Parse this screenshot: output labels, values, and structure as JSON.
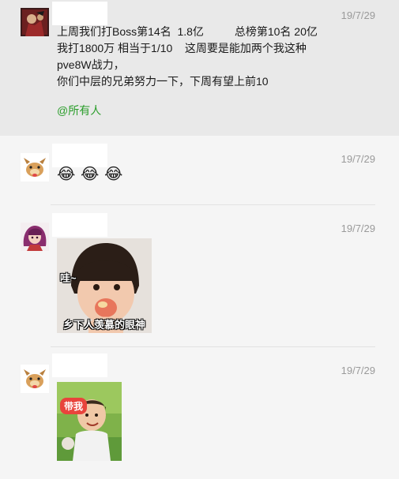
{
  "messages": [
    {
      "avatar_icon": "game-character-avatar-icon",
      "time": "19/7/29",
      "text_lines": [
        "上周我们打Boss第14名  1.8亿          总榜第10名 20亿",
        "我打1800万 相当于1/10    这周要是能加两个我这种pve8W战力，",
        "你们中层的兄弟努力一下，下周有望上前10"
      ],
      "mention": "@所有人"
    },
    {
      "avatar_icon": "cartoon-dog-avatar-icon",
      "time": "19/7/29",
      "emojis": [
        "😂",
        "😂",
        "😂"
      ]
    },
    {
      "avatar_icon": "anime-girl-avatar-icon",
      "time": "19/7/29",
      "sticker_icon": "child-eating-apple-sticker-icon",
      "sticker_tag": "哇~",
      "sticker_caption": "乡下人羡慕的眼神"
    },
    {
      "avatar_icon": "cartoon-dog-avatar-icon",
      "time": "19/7/29",
      "sticker_icon": "child-outdoors-sticker-icon",
      "sticker_badge": "带我"
    }
  ],
  "colors": {
    "page_bg": "#f5f5f5",
    "highlight_bg": "#e9e9e9",
    "mention": "#2a9d2a",
    "time": "#9a9a9a"
  }
}
